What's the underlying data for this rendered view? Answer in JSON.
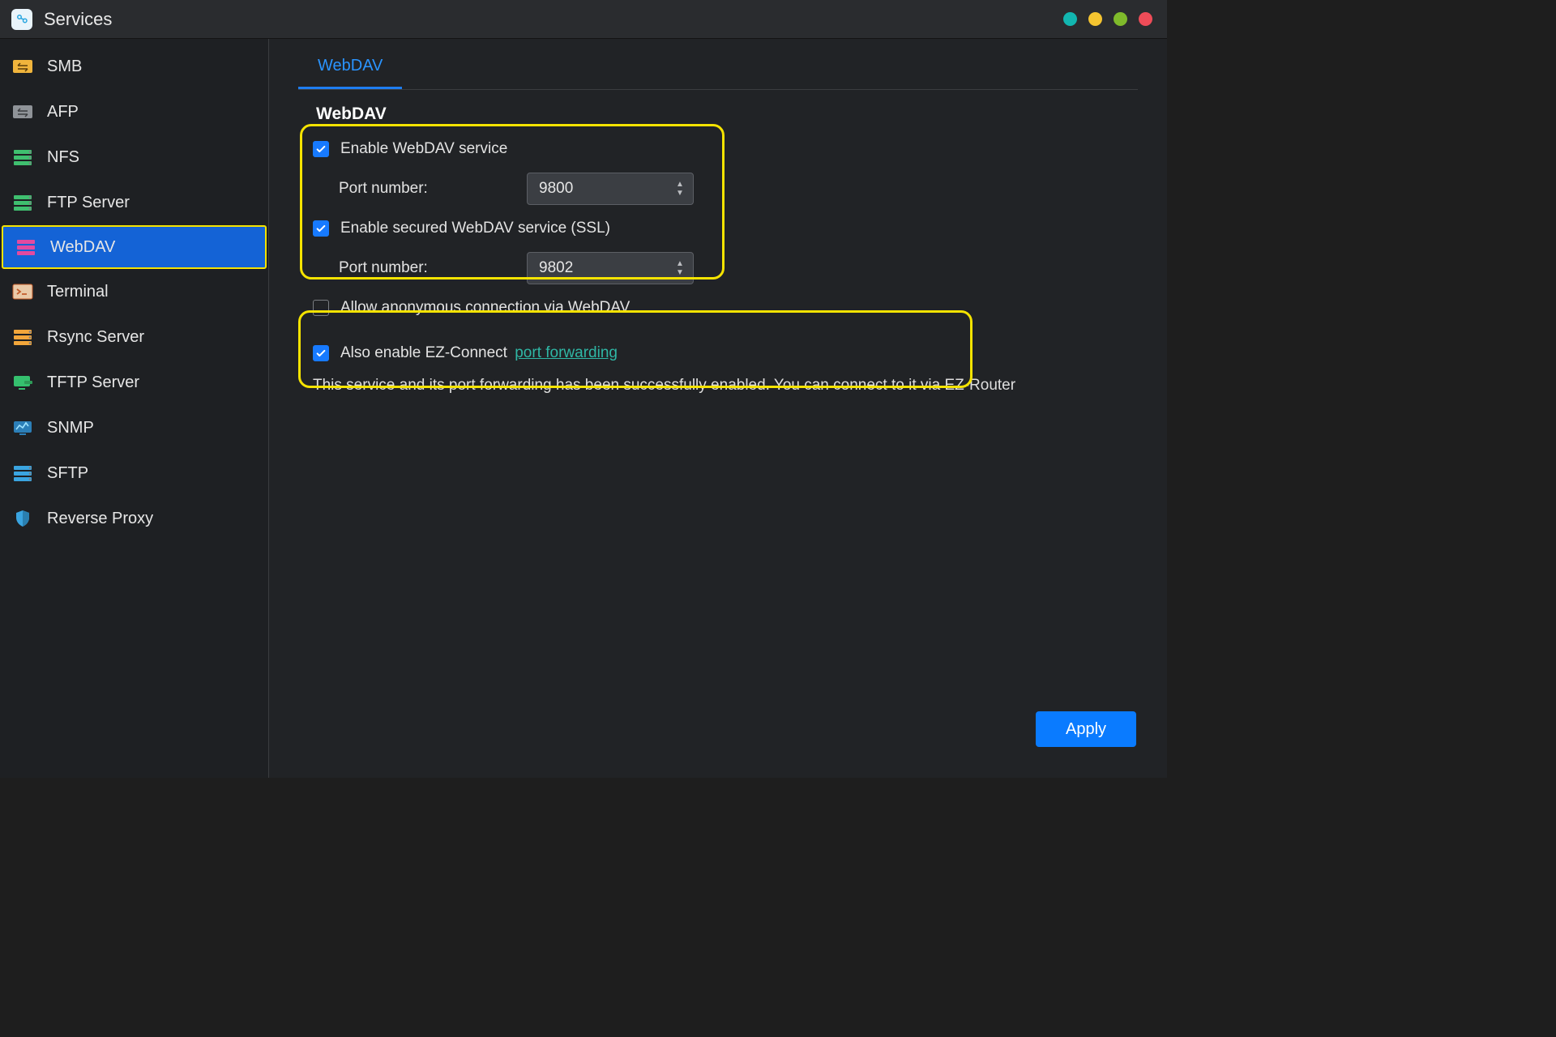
{
  "header": {
    "title": "Services",
    "dot_colors": [
      "#12b6b0",
      "#f4c430",
      "#7fba2b",
      "#ee4c58"
    ]
  },
  "sidebar": {
    "items": [
      {
        "label": "SMB"
      },
      {
        "label": "AFP"
      },
      {
        "label": "NFS"
      },
      {
        "label": "FTP Server"
      },
      {
        "label": "WebDAV",
        "active": true
      },
      {
        "label": "Terminal"
      },
      {
        "label": "Rsync Server"
      },
      {
        "label": "TFTP Server"
      },
      {
        "label": "SNMP"
      },
      {
        "label": "SFTP"
      },
      {
        "label": "Reverse Proxy"
      }
    ]
  },
  "tabs": {
    "active": "WebDAV"
  },
  "webdav": {
    "section_title": "WebDAV",
    "enable_label": "Enable WebDAV service",
    "enable_checked": true,
    "port_label": "Port number:",
    "port_value": "9800",
    "enable_ssl_label": "Enable secured WebDAV service (SSL)",
    "enable_ssl_checked": true,
    "ssl_port_label": "Port number:",
    "ssl_port_value": "9802",
    "allow_anon_label": "Allow anonymous connection via WebDAV",
    "allow_anon_checked": false,
    "ezconnect_label": "Also enable EZ-Connect ",
    "ezconnect_link": "port forwarding",
    "ezconnect_checked": true,
    "status_text": "This service and its port forwarding has been successfully enabled. You can connect to it via EZ-Router"
  },
  "buttons": {
    "apply": "Apply"
  }
}
